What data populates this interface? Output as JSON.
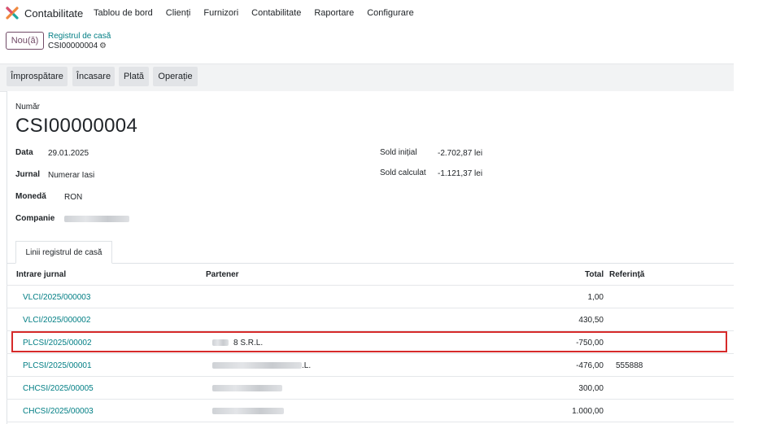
{
  "app": {
    "name": "Contabilitate",
    "menu": [
      "Tablou de bord",
      "Clienți",
      "Furnizori",
      "Contabilitate",
      "Raportare",
      "Configurare"
    ]
  },
  "control": {
    "new_label": "Nou(ă)",
    "breadcrumb_parent": "Registrul de casă",
    "breadcrumb_current": "CSI00000004"
  },
  "status_buttons": [
    "Împrospătare",
    "Încasare",
    "Plată",
    "Operație"
  ],
  "form": {
    "number_label": "Număr",
    "number": "CSI00000004",
    "date_label": "Data",
    "date": "29.01.2025",
    "journal_label": "Jurnal",
    "journal": "Numerar Iasi",
    "currency_label": "Monedă",
    "currency": "RON",
    "company_label": "Companie",
    "opening_label": "Sold inițial",
    "opening": "-2.702,87 lei",
    "computed_label": "Sold calculat",
    "computed": "-1.121,37 lei"
  },
  "tab_label": "Linii registrul de casă",
  "table": {
    "headers": {
      "entry": "Intrare jurnal",
      "partner": "Partener",
      "total": "Total",
      "ref": "Referință"
    },
    "rows": [
      {
        "entry": "VLCI/2025/000003",
        "partner": "",
        "total": "1,00",
        "ref": ""
      },
      {
        "entry": "VLCI/2025/000002",
        "partner": "",
        "total": "430,50",
        "ref": ""
      },
      {
        "entry": "PLCSI/2025/00002",
        "partner": "8 S.R.L.",
        "total": "-750,00",
        "ref": ""
      },
      {
        "entry": "PLCSI/2025/00001",
        "partner": ".L.",
        "total": "-476,00",
        "ref": "555888"
      },
      {
        "entry": "CHCSI/2025/00005",
        "partner": "",
        "total": "300,00",
        "ref": ""
      },
      {
        "entry": "CHCSI/2025/00003",
        "partner": "",
        "total": "1.000,00",
        "ref": ""
      }
    ]
  },
  "colors": {
    "accent": "#714b67",
    "link": "#017e84",
    "highlight": "#d62a2a"
  }
}
